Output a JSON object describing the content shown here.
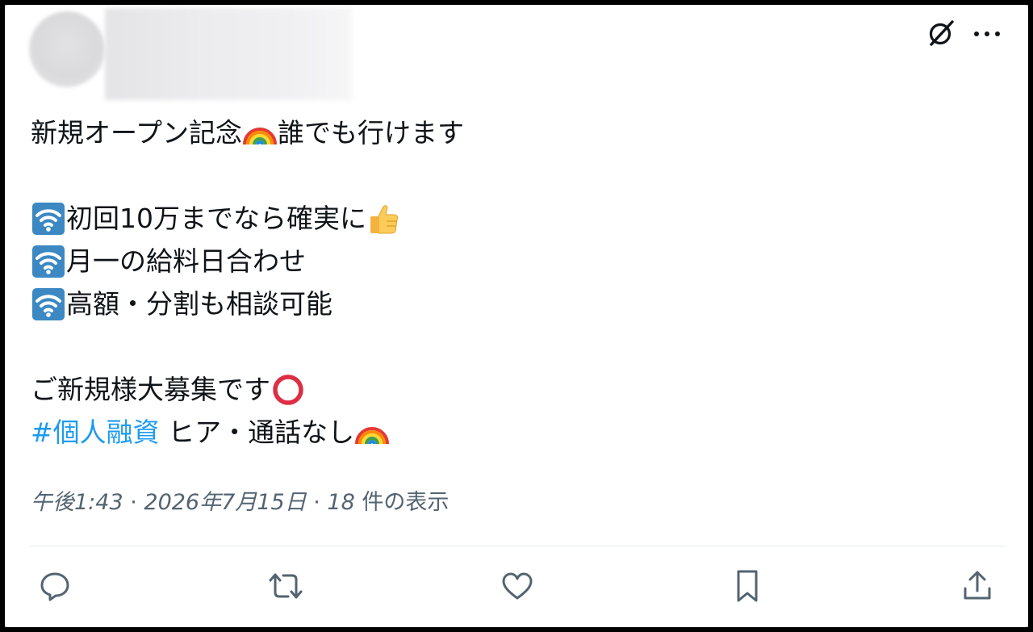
{
  "tweet": {
    "lines": [
      {
        "pre": "新規オープン記念",
        "post": "誰でも行けます"
      },
      {
        "pre": "",
        "post": "初回10万までなら確実に"
      },
      {
        "pre": "",
        "post": "月一の給料日合わせ"
      },
      {
        "pre": "",
        "post": "高額・分割も相談可能"
      },
      {
        "pre": "ご新規様大募集です",
        "post": ""
      },
      {
        "hashtag": "#個人融資",
        "post": " ヒア・通話なし"
      }
    ]
  },
  "meta": {
    "time": "午後1:43",
    "sep1": " · ",
    "date": "2026年7月15日",
    "sep2": " · ",
    "views_count": "18",
    "views_label": " 件の表示"
  },
  "icons": {
    "grok": "grok-icon",
    "more": "more-options-icon",
    "rainbow": "rainbow-emoji",
    "wifi": "antenna-bars-emoji",
    "thumbs": "thumbs-up-emoji",
    "circle": "red-circle-emoji",
    "reply": "reply-icon",
    "retweet": "retweet-icon",
    "like": "like-icon",
    "bookmark": "bookmark-icon",
    "share": "share-icon"
  },
  "colors": {
    "text": "#0f1419",
    "meta": "#536471",
    "hashtag": "#1d9bf0",
    "action_icon": "#536471"
  }
}
